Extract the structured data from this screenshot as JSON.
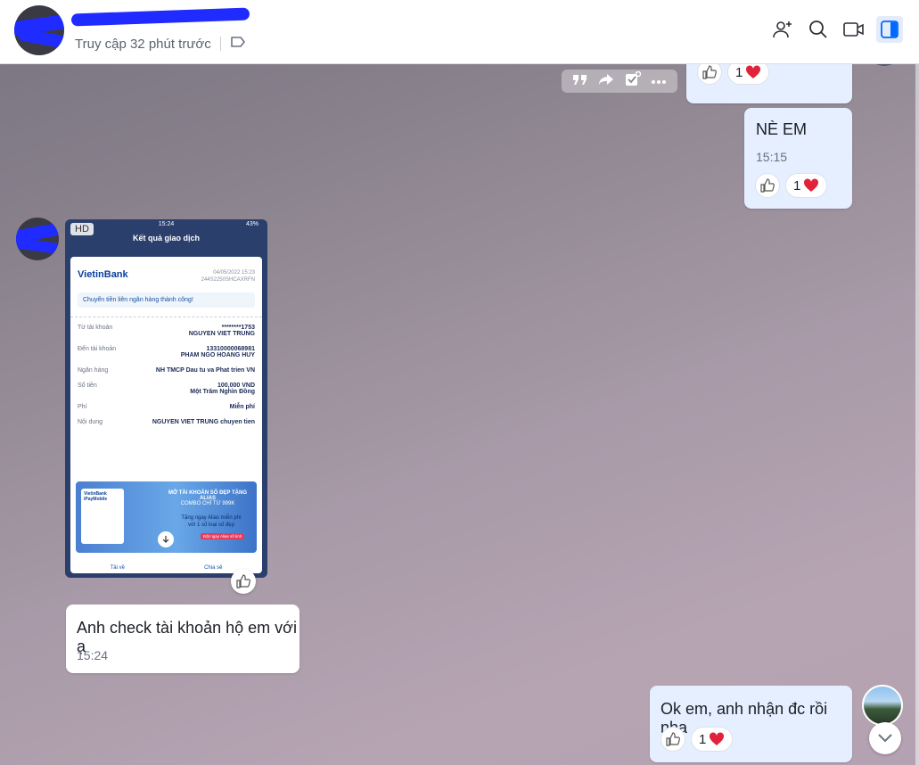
{
  "header": {
    "status": "Truy cập 32 phút trước",
    "icons": [
      "add-member-icon",
      "search-icon",
      "video-call-icon",
      "sidebar-toggle-icon"
    ]
  },
  "messages": {
    "top_reactions": {
      "heart_count": "1"
    },
    "ne_em": {
      "text": "NÈ EM",
      "time": "15:15",
      "heart_count": "1"
    },
    "image": {
      "badge": "HD",
      "phone_time": "15:24",
      "battery": "43%",
      "screen_title": "Kết quả giao dịch",
      "bank": "VietinBank",
      "date": "04/05/2022 15:23",
      "ref": "244S2250SHCAXRFN",
      "success": "Chuyển tiền liên ngân hàng thành công!",
      "rows": [
        {
          "label": "Từ tài khoản",
          "value": "********1753",
          "value2": "NGUYEN VIET TRUNG"
        },
        {
          "label": "Đến tài khoản",
          "value": "13310000068981",
          "value2": "PHAM NGO HOANG HUY"
        },
        {
          "label": "Ngân hàng",
          "value": "NH TMCP Dau tu va Phat trien VN",
          "value2": ""
        },
        {
          "label": "Số tiền",
          "value": "100,000 VND",
          "value2": "Một Trăm Nghìn Đồng"
        },
        {
          "label": "Phí",
          "value": "Miễn phí",
          "value2": ""
        },
        {
          "label": "Nội dung",
          "value": "NGUYEN VIET TRUNG chuyen tien",
          "value2": ""
        }
      ],
      "banner_title": "MỞ TÀI KHOẢN SỐ ĐẸP TẶNG ALIAS",
      "banner_sub": "COMBO CHỈ TỪ 999K",
      "banner_line1": "Tặng ngay Alias miễn phí",
      "banner_line2": "với 1 số loại số đẹp",
      "banner_cta": "Đặt ngay Alias số tinh",
      "banner_brand": "VietinBank iPayMobile",
      "download": "Tải về",
      "share": "Chia sẻ"
    },
    "anh_check": {
      "text": "Anh check tài khoản hộ em với ạ",
      "time": "15:24"
    },
    "ok_em": {
      "text": "Ok em, anh nhận đc rồi nha",
      "heart_count": "1"
    }
  },
  "colors": {
    "accent": "#0068ff",
    "my_bubble": "#e5efff",
    "heart": "#e0233a"
  }
}
